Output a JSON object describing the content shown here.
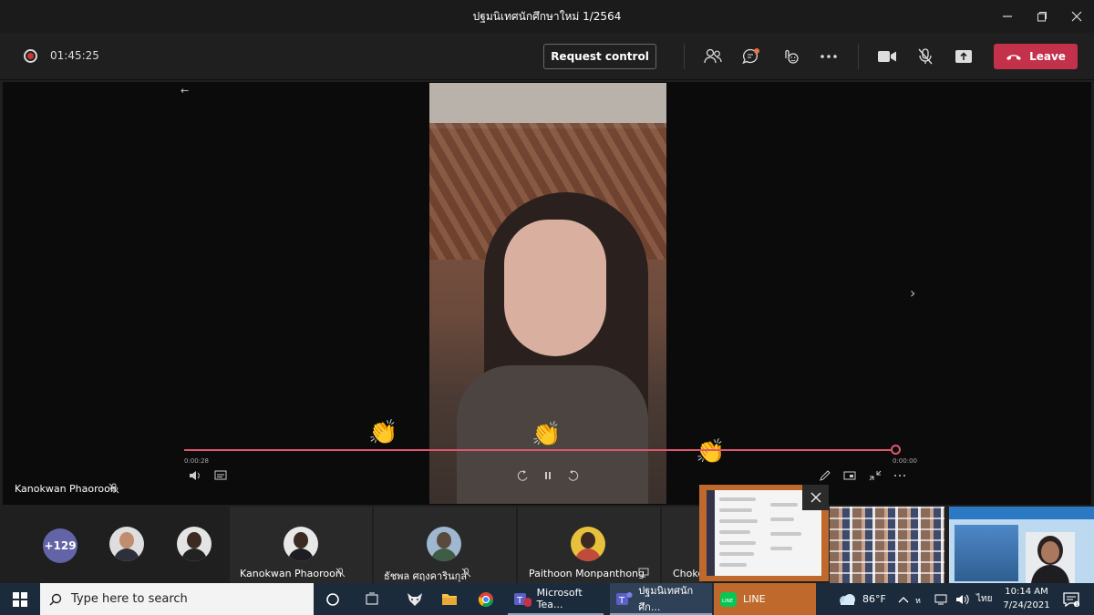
{
  "window": {
    "title": "ปฐมนิเทศนักศึกษาใหม่ 1/2564",
    "minimize_icon": "minimize-icon",
    "restore_icon": "restore-icon",
    "close_icon": "close-icon"
  },
  "meeting_bar": {
    "recording_time": "01:45:25",
    "request_control_label": "Request control",
    "leave_label": "Leave",
    "leave_color": "#c4314b",
    "icons": [
      "people-icon",
      "chat-icon",
      "react-icon",
      "more-icon",
      "camera-icon",
      "mic-muted-icon",
      "share-icon",
      "phone-hangup-icon"
    ]
  },
  "player": {
    "time_elapsed": "0:00:28",
    "time_remaining": "0:00:00",
    "accent": "#e0566f",
    "reactions": [
      "👏",
      "👏",
      "👏"
    ]
  },
  "pinned_participant": {
    "name": "Kanokwan Phaoroon"
  },
  "participants_strip": {
    "overflow_count": "+129",
    "tiles": [
      {
        "name": "Kanokwan Phaoroon"
      },
      {
        "name": "ธัชพล ศฤงคารินกุล"
      },
      {
        "name": "Paithoon Monpanthong"
      },
      {
        "name": "Choke"
      }
    ]
  },
  "taskbar": {
    "search_placeholder": "Type here to search",
    "apps": [
      {
        "label": "Microsoft Tea..."
      },
      {
        "label": "ปฐมนิเทศนักศึก..."
      },
      {
        "label": "LINE"
      }
    ],
    "weather": "86°F",
    "language": "ไทย",
    "time": "10:14 AM",
    "date": "7/24/2021",
    "line_color": "#c0692c"
  }
}
